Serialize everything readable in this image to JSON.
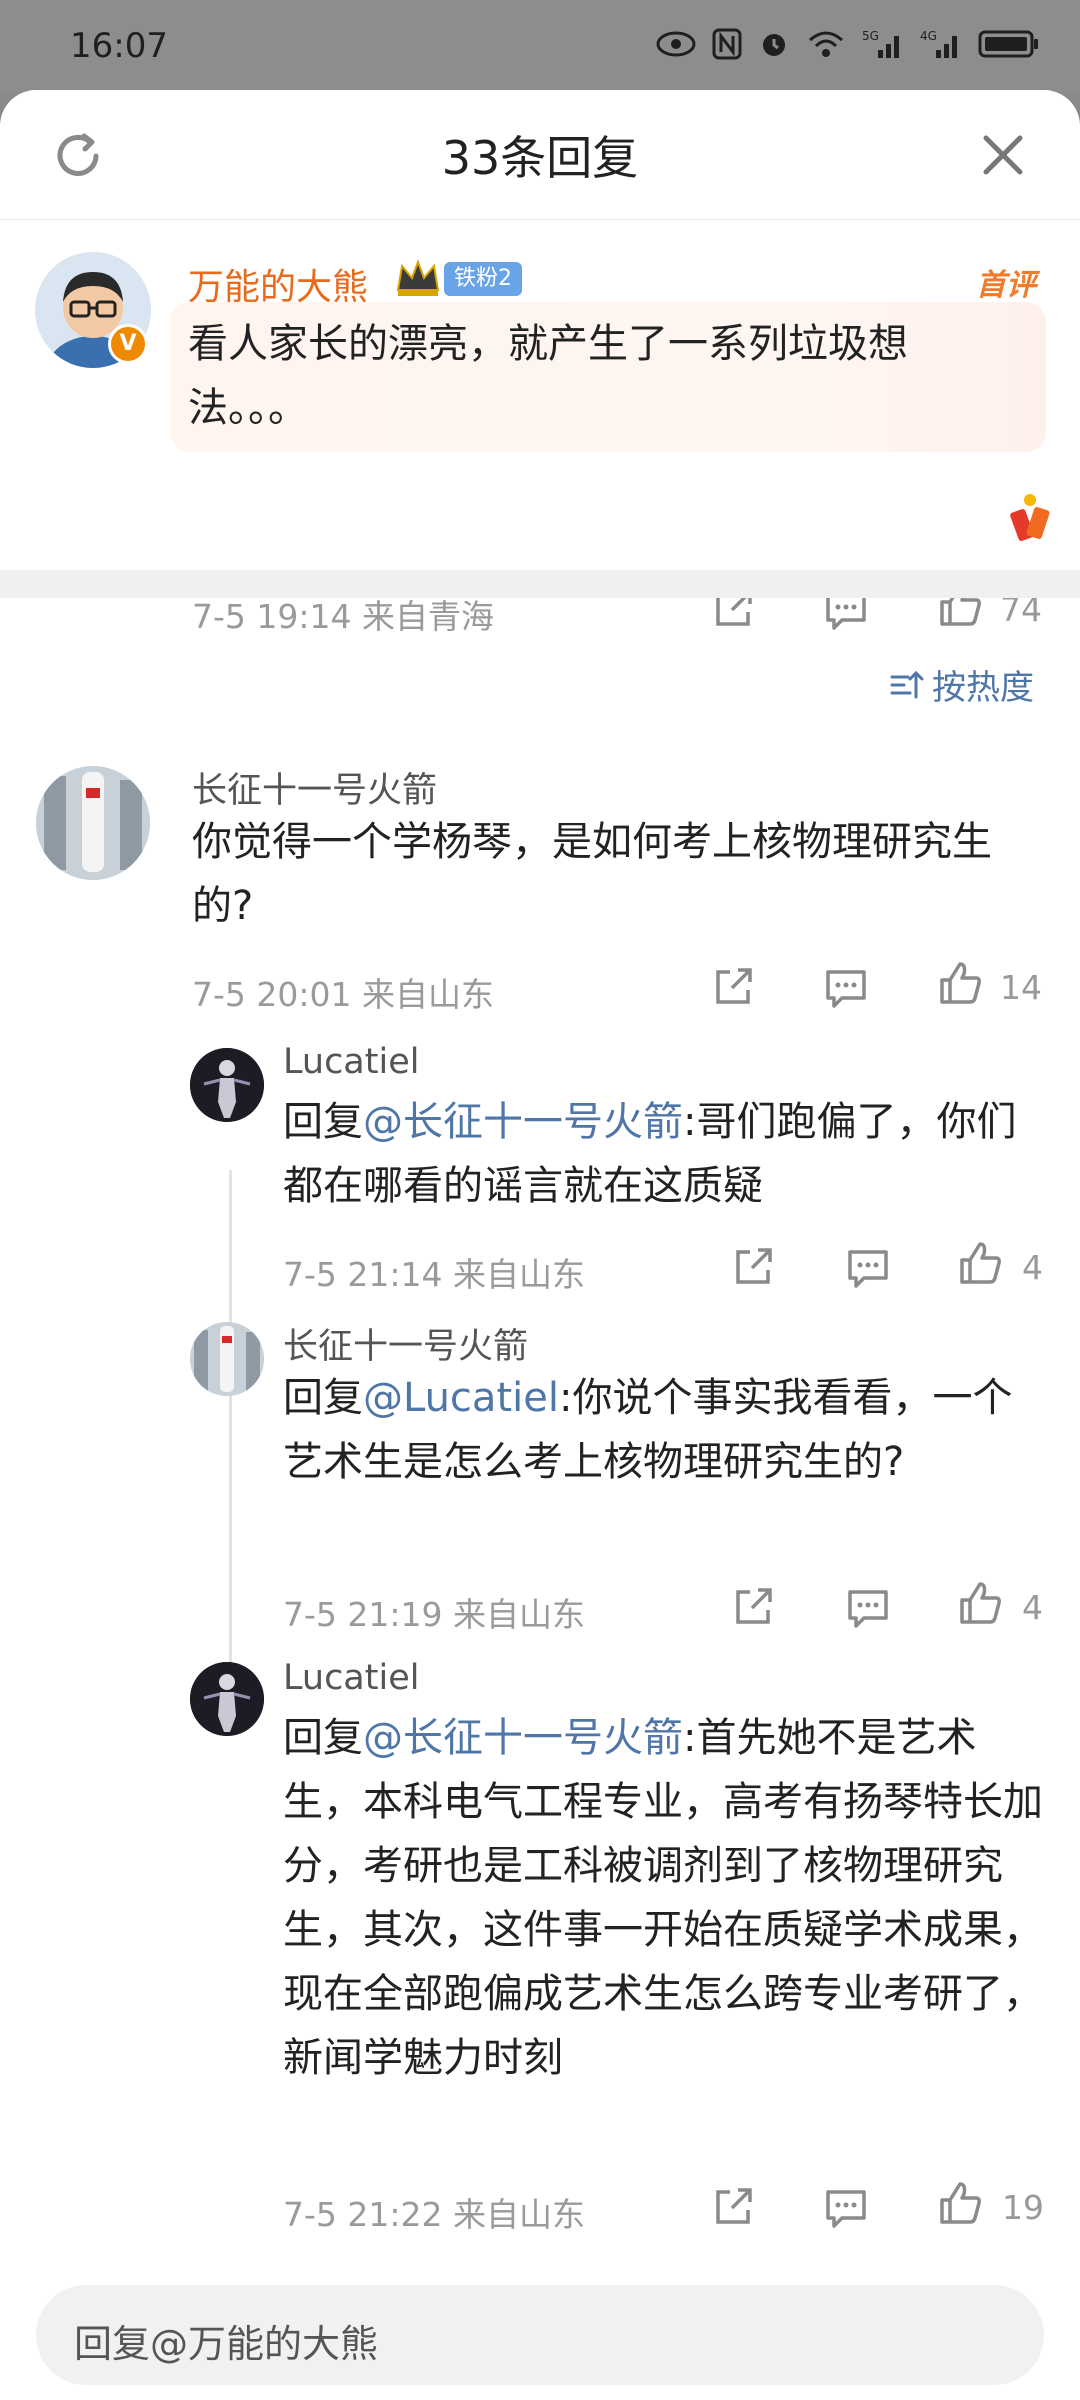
{
  "status_bar": {
    "time": "16:07"
  },
  "header": {
    "title": "33条回复"
  },
  "main_comment": {
    "author": "万能的大熊",
    "fan_badge": "铁粉2",
    "first_badge": "首评",
    "text": "看人家长的漂亮，就产生了一系列垃圾想法。。。",
    "time_location": "7-5 19:14 来自青海",
    "likes": "74"
  },
  "sort": {
    "label": "按热度"
  },
  "comments": [
    {
      "author": "长征十一号火箭",
      "text": "你觉得一个学杨琴，是如何考上核物理研究生的?",
      "time_location": "7-5 20:01 来自山东",
      "likes": "14"
    }
  ],
  "replies": [
    {
      "author": "Lucatiel",
      "prefix": "回复",
      "mention": "@长征十一号火箭",
      "body": ":哥们跑偏了，你们都在哪看的谣言就在这质疑",
      "time_location": "7-5 21:14 来自山东",
      "likes": "4"
    },
    {
      "author": "长征十一号火箭",
      "prefix": "回复",
      "mention": "@Lucatiel",
      "body": ":你说个事实我看看，一个艺术生是怎么考上核物理研究生的?",
      "time_location": "7-5 21:19 来自山东",
      "likes": "4"
    },
    {
      "author": "Lucatiel",
      "prefix": "回复",
      "mention": "@长征十一号火箭",
      "body": ":首先她不是艺术生，本科电气工程专业，高考有扬琴特长加分，考研也是工科被调剂到了核物理研究生，其次，这件事一开始在质疑学术成果，现在全部跑偏成艺术生怎么跨专业考研了，新闻学魅力时刻",
      "time_location": "7-5 21:22 来自山东",
      "likes": "19"
    }
  ],
  "reply_input": {
    "placeholder": "回复@万能的大熊"
  }
}
